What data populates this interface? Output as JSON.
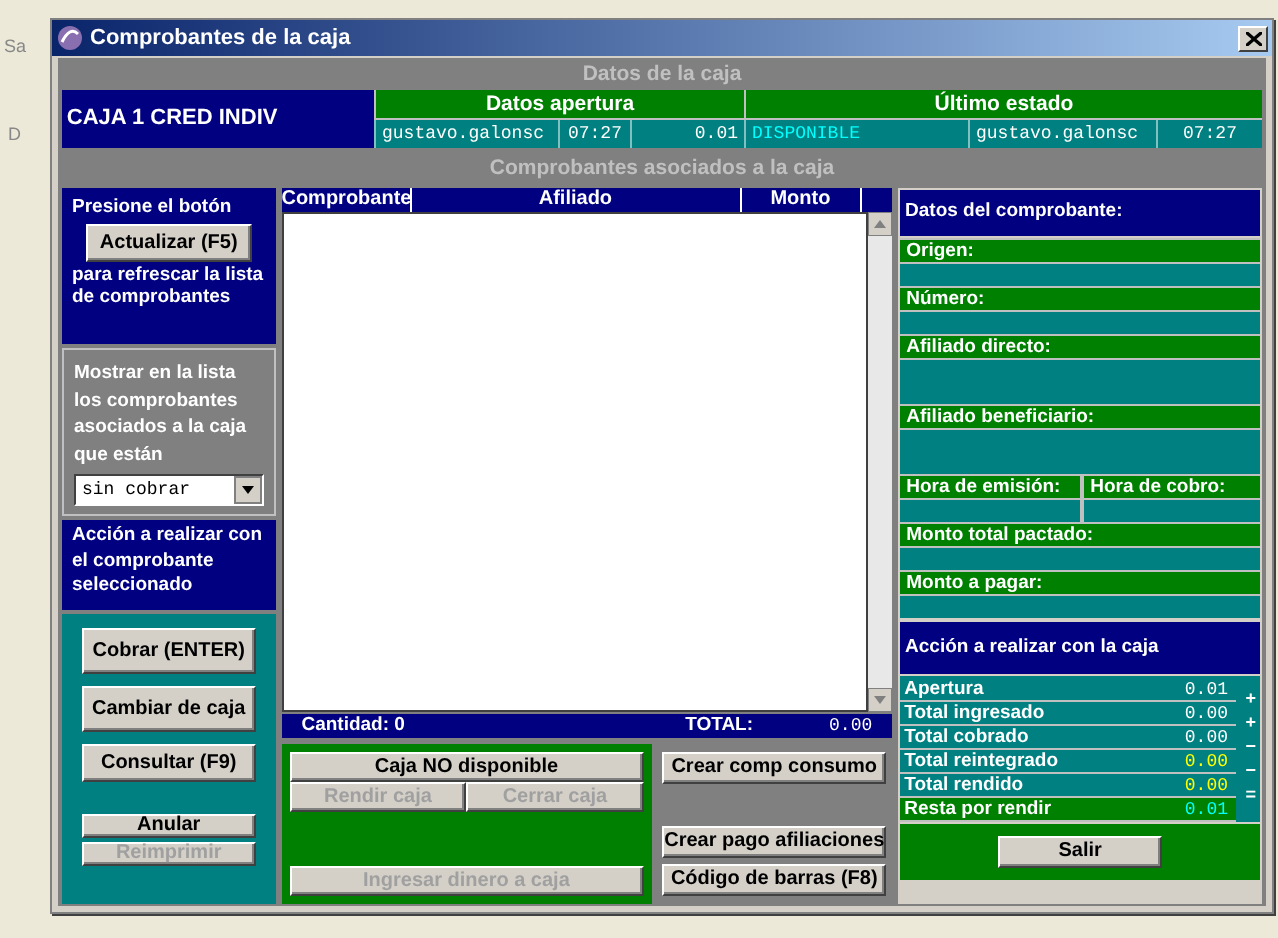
{
  "background": {
    "fragments": [
      "Sa",
      "D"
    ]
  },
  "window": {
    "title": "Comprobantes de la caja"
  },
  "caja_header": "Datos de la caja",
  "caja": {
    "name": "CAJA 1 CRED INDIV",
    "apertura": {
      "heading": "Datos apertura",
      "user": "gustavo.galonsc",
      "time": "07:27",
      "amount": "0.01"
    },
    "ultimo_estado": {
      "heading": "Último estado",
      "status": "DISPONIBLE",
      "user": "gustavo.galonsc",
      "time": "07:27"
    }
  },
  "comprobantes_header": "Comprobantes asociados a la caja",
  "left": {
    "refresh_before": "Presione el botón",
    "refresh_button": "Actualizar (F5)",
    "refresh_after": "para refrescar la lista de comprobantes",
    "filter_label": "Mostrar en la lista los comprobantes asociados a la caja que están",
    "filter_value": "sin cobrar",
    "action_label": "Acción a realizar con el comprobante seleccionado",
    "buttons": [
      {
        "label": "Cobrar (ENTER)",
        "kind": "large",
        "disabled": false
      },
      {
        "label": "Cambiar de caja",
        "kind": "large",
        "disabled": false
      },
      {
        "label": "Consultar (F9)",
        "kind": "medium",
        "disabled": false
      },
      {
        "label": "Anular",
        "kind": "small",
        "disabled": false
      },
      {
        "label": "Reimprimir",
        "kind": "small",
        "disabled": true
      }
    ]
  },
  "table": {
    "columns": [
      "Comprobante",
      "Afiliado",
      "Monto"
    ],
    "count": "Cantidad: 0",
    "total_label": "TOTAL:",
    "total": "0.00"
  },
  "caja_actions": [
    {
      "label": "Caja NO disponible",
      "disabled": false
    },
    {
      "label": "Rendir caja",
      "disabled": true
    },
    {
      "label": "Cerrar caja",
      "disabled": true
    },
    {
      "label": "Ingresar dinero a caja",
      "disabled": true
    }
  ],
  "create_actions": [
    {
      "label": "Crear comp consumo",
      "disabled": false
    },
    {
      "label": "Crear pago afiliaciones",
      "disabled": false
    },
    {
      "label": "Código de barras (F8)",
      "disabled": false
    }
  ],
  "detail": {
    "title": "Datos del comprobante:",
    "fields": [
      {
        "kind": "short",
        "labels": [
          "Origen:"
        ]
      },
      {
        "kind": "short",
        "labels": [
          "Número:"
        ]
      },
      {
        "kind": "tall",
        "labels": [
          "Afiliado directo:"
        ]
      },
      {
        "kind": "tall",
        "labels": [
          "Afiliado beneficiario:"
        ]
      },
      {
        "kind": "split",
        "labels": [
          "Hora de emisión:",
          "Hora de cobro:"
        ]
      },
      {
        "kind": "short",
        "labels": [
          "Monto total pactado:"
        ]
      },
      {
        "kind": "short",
        "labels": [
          "Monto a pagar:"
        ]
      }
    ]
  },
  "totals": {
    "title": "Acción a realizar con la caja",
    "rows": [
      {
        "label": "Apertura",
        "value": "0.01",
        "kind": "plain"
      },
      {
        "label": "Total ingresado",
        "value": "0.00",
        "kind": "plain"
      },
      {
        "label": "Total cobrado",
        "value": "0.00",
        "kind": "plain"
      },
      {
        "label": "Total reintegrado",
        "value": "0.00",
        "kind": "outflow"
      },
      {
        "label": "Total rendido",
        "value": "0.00",
        "kind": "outflow"
      },
      {
        "label": "Resta por rendir",
        "value": "0.01",
        "kind": "result"
      }
    ],
    "operators": [
      "+",
      "+",
      "−",
      "−",
      "="
    ]
  },
  "exit_button": "Salir"
}
